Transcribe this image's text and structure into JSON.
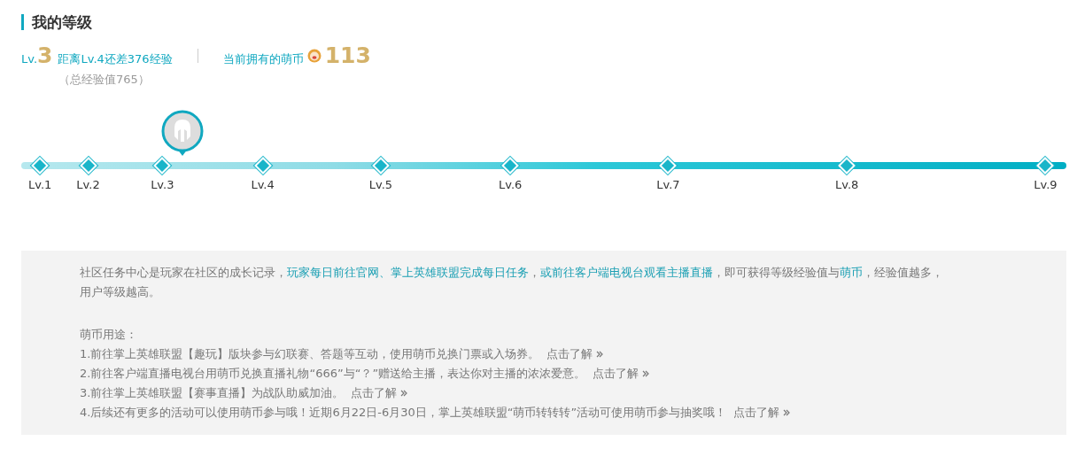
{
  "title": "我的等级",
  "summary": {
    "level_prefix": "Lv.",
    "level": "3",
    "gap": "距离Lv.4还差376经验",
    "total": "（总经验值765）",
    "coins_label": "当前拥有的萌币",
    "coins": "113"
  },
  "levels": [
    {
      "label": "Lv.1",
      "current": false
    },
    {
      "label": "Lv.2",
      "current": false
    },
    {
      "label": "Lv.3",
      "current": true
    },
    {
      "label": "Lv.4",
      "current": false
    },
    {
      "label": "Lv.5",
      "current": false
    },
    {
      "label": "Lv.6",
      "current": false
    },
    {
      "label": "Lv.7",
      "current": false
    },
    {
      "label": "Lv.8",
      "current": false
    },
    {
      "label": "Lv.9",
      "current": false
    }
  ],
  "intro": [
    {
      "text": "社区任务中心是玩家在社区的成长记录，",
      "highlight": false
    },
    {
      "text": "玩家每日前往官网、掌上英雄联盟完成每日任务",
      "highlight": true
    },
    {
      "text": "，",
      "highlight": false
    },
    {
      "text": "或前往客户端电视台观看主播直播",
      "highlight": true
    },
    {
      "text": "，即可获得等级经验值与",
      "highlight": false
    },
    {
      "text": "萌币",
      "highlight": true
    },
    {
      "text": "，经验值越多，用户等级越高。",
      "highlight": false
    }
  ],
  "uses_title": "萌币用途：",
  "uses": [
    {
      "text": "1.前往掌上英雄联盟【趣玩】版块参与幻联赛、答题等互动，使用萌币兑换门票或入场券。",
      "link": "点击了解"
    },
    {
      "text": "2.前往客户端直播电视台用萌币兑换直播礼物“666”与“？”赠送给主播，表达你对主播的浓浓爱意。",
      "link": "点击了解"
    },
    {
      "text": "3.前往掌上英雄联盟【赛事直播】为战队助威加油。",
      "link": "点击了解"
    },
    {
      "text": "4.后续还有更多的活动可以使用萌币参与哦！近期6月22日-6月30日，掌上英雄联盟“萌币转转转”活动可使用萌币参与抽奖哦！",
      "link": "点击了解"
    }
  ]
}
